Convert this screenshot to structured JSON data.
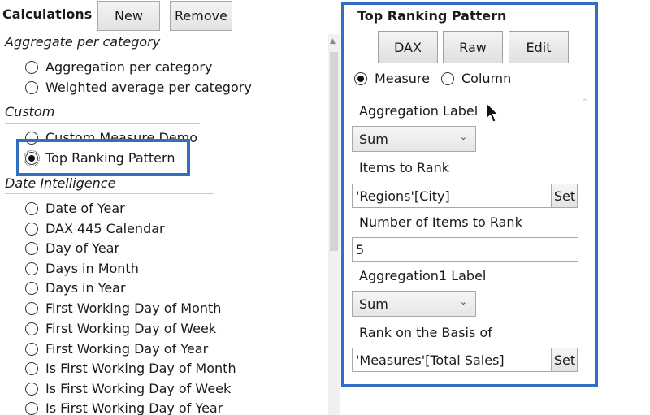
{
  "left": {
    "title": "Calculations",
    "new_label": "New",
    "remove_label": "Remove",
    "groups": {
      "aggregate": {
        "label": "Aggregate per category",
        "items": [
          "Aggregation per category",
          "Weighted average per category"
        ]
      },
      "custom": {
        "label": "Custom",
        "items": [
          "Custom Measure Demo",
          "Top Ranking Pattern"
        ],
        "selected": "Top Ranking Pattern"
      },
      "date": {
        "label": "Date Intelligence",
        "items": [
          "Date of Year",
          "DAX 445 Calendar",
          "Day of Year",
          "Days in Month",
          "Days in Year",
          "First Working Day of Month",
          "First Working Day of Week",
          "First Working Day of Year",
          "Is First Working Day of Month",
          "Is First Working Day of Week",
          "Is First Working Day of Year"
        ]
      }
    }
  },
  "panel": {
    "title": "Top Ranking Pattern",
    "tabs": [
      "DAX",
      "Raw",
      "Edit"
    ],
    "type_options": [
      "Measure",
      "Column"
    ],
    "type_selected": "Measure",
    "aggregation_label": {
      "label": "Aggregation Label",
      "value": "Sum"
    },
    "items_to_rank": {
      "label": "Items to Rank",
      "value": "'Regions'[City]",
      "set_label": "Set"
    },
    "number_of_items": {
      "label": "Number of Items to Rank",
      "value": "5"
    },
    "aggregation1_label": {
      "label": "Aggregation1 Label",
      "value": "Sum"
    },
    "rank_basis": {
      "label": "Rank on the Basis of",
      "value": "'Measures'[Total Sales]",
      "set_label": "Set"
    }
  },
  "colors": {
    "highlight": "#2f6ec0"
  },
  "icons": {
    "dropdown": "chevron-down-icon",
    "pointer": "mouse-pointer-icon"
  }
}
